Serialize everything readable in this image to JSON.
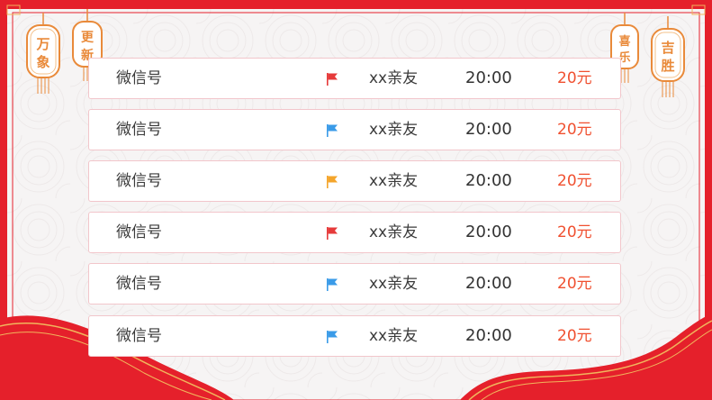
{
  "colors": {
    "frame_red": "#e5202b",
    "paper": "#f6f4f4",
    "row_border": "#f2c6cb",
    "amount_red": "#f05030",
    "lantern_orange": "#e98a3a",
    "gold_line": "#f1b55c"
  },
  "lanterns": [
    {
      "id": "wan-xiang",
      "chars": [
        "万",
        "象"
      ]
    },
    {
      "id": "geng-xin",
      "chars": [
        "更",
        "新"
      ]
    },
    {
      "id": "xi-le",
      "chars": [
        "喜",
        "乐"
      ]
    },
    {
      "id": "ji-sheng",
      "chars": [
        "吉",
        "胜"
      ]
    }
  ],
  "rows": [
    {
      "label": "微信号",
      "flag_color": "#e63a3a",
      "flag_icon": "flag-icon",
      "name": "xx亲友",
      "time": "20:00",
      "amount": "20元"
    },
    {
      "label": "微信号",
      "flag_color": "#3a9be8",
      "flag_icon": "flag-icon",
      "name": "xx亲友",
      "time": "20:00",
      "amount": "20元"
    },
    {
      "label": "微信号",
      "flag_color": "#f4a52b",
      "flag_icon": "flag-icon",
      "name": "xx亲友",
      "time": "20:00",
      "amount": "20元"
    },
    {
      "label": "微信号",
      "flag_color": "#e63a3a",
      "flag_icon": "flag-icon",
      "name": "xx亲友",
      "time": "20:00",
      "amount": "20元"
    },
    {
      "label": "微信号",
      "flag_color": "#3a9be8",
      "flag_icon": "flag-icon",
      "name": "xx亲友",
      "time": "20:00",
      "amount": "20元"
    },
    {
      "label": "微信号",
      "flag_color": "#3a9be8",
      "flag_icon": "flag-icon",
      "name": "xx亲友",
      "time": "20:00",
      "amount": "20元"
    }
  ]
}
